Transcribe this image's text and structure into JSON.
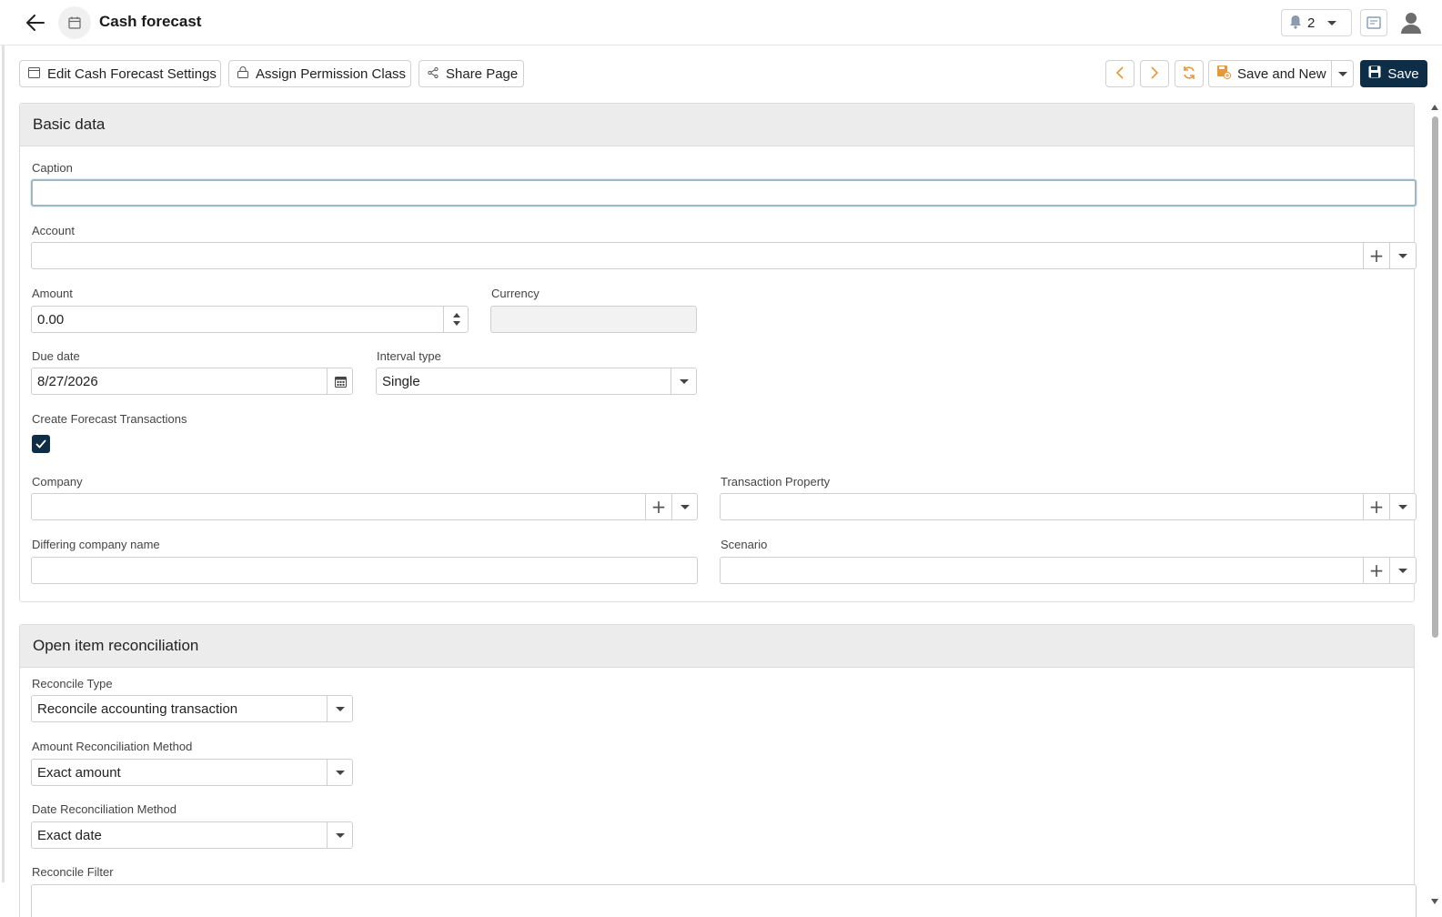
{
  "header": {
    "title": "Cash forecast",
    "notifications_count": "2"
  },
  "toolbar": {
    "edit_settings": "Edit Cash Forecast Settings",
    "assign_permission": "Assign Permission Class",
    "share_page": "Share Page",
    "save_and_new": "Save and New",
    "save": "Save"
  },
  "basic": {
    "title": "Basic data",
    "caption_label": "Caption",
    "caption_value": "",
    "account_label": "Account",
    "account_value": "",
    "amount_label": "Amount",
    "amount_value": "0.00",
    "currency_label": "Currency",
    "currency_value": "",
    "due_date_label": "Due date",
    "due_date_value": "8/27/2026",
    "interval_label": "Interval type",
    "interval_value": "Single",
    "create_tx_label": "Create Forecast Transactions",
    "create_tx_checked": true,
    "company_label": "Company",
    "company_value": "",
    "tx_property_label": "Transaction Property",
    "tx_property_value": "",
    "differing_label": "Differing company name",
    "differing_value": "",
    "scenario_label": "Scenario",
    "scenario_value": ""
  },
  "open": {
    "title": "Open item reconciliation",
    "reconcile_type_label": "Reconcile Type",
    "reconcile_type_value": "Reconcile accounting transaction",
    "amount_method_label": "Amount Reconciliation Method",
    "amount_method_value": "Exact amount",
    "date_method_label": "Date Reconciliation Method",
    "date_method_value": "Exact date",
    "filter_label": "Reconcile Filter"
  },
  "colors": {
    "primary": "#0e2d47",
    "accent_orange": "#e8963a"
  }
}
